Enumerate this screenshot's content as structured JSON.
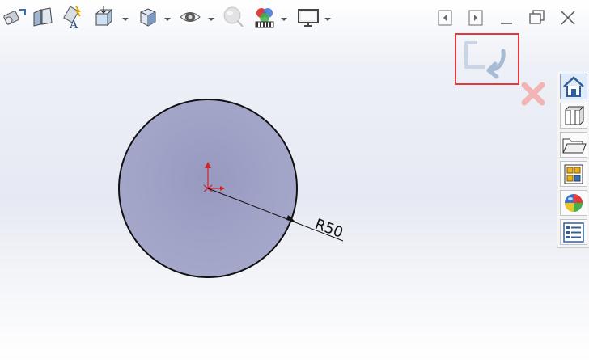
{
  "toolbar": {
    "icons": [
      "view-orientation-icon",
      "section-view-icon",
      "dynamic-annotation-icon",
      "display-style-icon",
      "hide-show-items-icon",
      "edit-appearance-icon",
      "apply-scene-icon",
      "view-settings-icon",
      "display-pane-icon"
    ]
  },
  "window_controls": {
    "icons": [
      "tile-left-icon",
      "tile-right-icon",
      "minimize-icon",
      "restore-icon",
      "close-icon"
    ]
  },
  "confirmation_corner": {
    "icons": [
      "exit-sketch-icon",
      "cancel-sketch-icon"
    ]
  },
  "task_pane": {
    "tabs": [
      "home-icon",
      "design-library-icon",
      "file-explorer-icon",
      "view-palette-icon",
      "appearances-scenes-icon",
      "custom-properties-icon"
    ]
  },
  "sketch": {
    "dimension_label": "R50",
    "colors": {
      "circle_fill": "#9a9cc2",
      "origin": "#d3232b",
      "confirm_border": "#e8373a"
    }
  }
}
